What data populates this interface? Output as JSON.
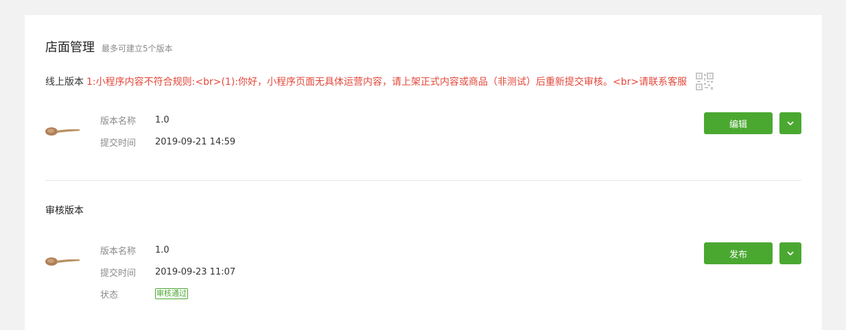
{
  "header": {
    "title": "店面管理",
    "subtitle": "最多可建立5个版本"
  },
  "online": {
    "label": "线上版本",
    "message": "1:小程序内容不符合规则:<br>(1):你好，小程序页面无具体运营内容，请上架正式内容或商品（非测试）后重新提交审核。<br>请联系客服",
    "qr_icon": "qrcode-icon"
  },
  "online_version": {
    "name_label": "版本名称",
    "name_value": "1.0",
    "time_label": "提交时间",
    "time_value": "2019-09-21 14:59",
    "button_label": "编辑"
  },
  "review": {
    "section_title": "审核版本",
    "name_label": "版本名称",
    "name_value": "1.0",
    "time_label": "提交时间",
    "time_value": "2019-09-23 11:07",
    "status_label": "状态",
    "status_value": "审核通过",
    "button_label": "发布"
  },
  "colors": {
    "accent": "#4aa831",
    "error": "#e2473a"
  }
}
